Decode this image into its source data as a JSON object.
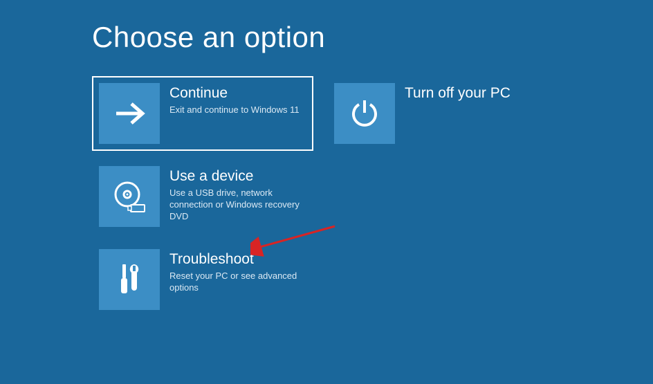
{
  "title": "Choose an option",
  "tiles": {
    "continue": {
      "title": "Continue",
      "desc": "Exit and continue to Windows 11",
      "icon": "arrow-right-icon",
      "selected": true
    },
    "turnoff": {
      "title": "Turn off your PC",
      "desc": "",
      "icon": "power-icon",
      "selected": false
    },
    "usedevice": {
      "title": "Use a device",
      "desc": "Use a USB drive, network connection or Windows recovery DVD",
      "icon": "disc-usb-icon",
      "selected": false
    },
    "troubleshoot": {
      "title": "Troubleshoot",
      "desc": "Reset your PC or see advanced options",
      "icon": "tools-icon",
      "selected": false
    }
  },
  "annotation": {
    "type": "pointer-arrow",
    "target": "troubleshoot"
  }
}
